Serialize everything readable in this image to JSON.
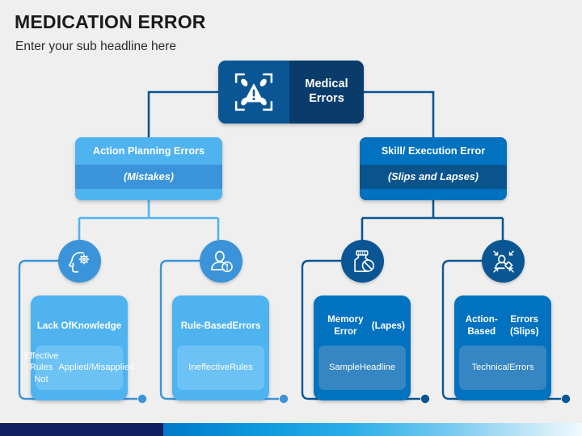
{
  "header": {
    "title": "MEDICATION ERROR",
    "subtitle": "Enter your sub headline here"
  },
  "colors": {
    "background": "#efefef",
    "root_icon_pane": "#0a5694",
    "root_label_pane": "#0a3c6b",
    "light_blue": "#4FB3F0",
    "light_blue_band": "#3B94D9",
    "light_blue_inner": "#6CC2F5",
    "dark_blue": "#0072C0",
    "dark_blue_band": "#0A548E",
    "dark_blue_inner": "#3586C2",
    "icon_circle_light": "#3B94D9",
    "icon_circle_dark": "#0A5694",
    "bar_navy": "#0E2060",
    "bar_gradient_start": "#0079C8",
    "bar_gradient_end": "#F0FAFE"
  },
  "root": {
    "icon": "medical-error-warning-icon",
    "label": "Medical\nErrors",
    "label_line1": "Medical",
    "label_line2": "Errors"
  },
  "branches": [
    {
      "id": "action-planning-errors",
      "title": "Action Planning Errors",
      "subtitle": "(Mistakes)",
      "theme": "light"
    },
    {
      "id": "skill-execution-error",
      "title": "Skill/ Execution Error",
      "subtitle": "(Slips and Lapses)",
      "theme": "dark"
    }
  ],
  "leaves": [
    {
      "id": "lack-of-knowledge",
      "icon": "head-gear-icon",
      "title_line1": "Lack Of",
      "title_line2": "Knowledge",
      "sub_line1": "Effective Rules Not",
      "sub_line2": "Applied/Misapplied",
      "theme": "light"
    },
    {
      "id": "rule-based-errors",
      "icon": "person-alert-icon",
      "title_line1": "Rule-Based",
      "title_line2": "Errors",
      "sub_line1": "Ineffective",
      "sub_line2": "Rules",
      "theme": "light"
    },
    {
      "id": "memory-error",
      "icon": "pill-bottle-icon",
      "title_line1": "Memory Error",
      "title_line2": "(Lapes)",
      "sub_line1": "Sample",
      "sub_line2": "Headline",
      "theme": "dark"
    },
    {
      "id": "action-based-errors",
      "icon": "person-arrows-icon",
      "title_line1": "Action-Based",
      "title_line2": "Errors (Slips)",
      "sub_line1": "Technical",
      "sub_line2": "Errors",
      "theme": "dark"
    }
  ]
}
